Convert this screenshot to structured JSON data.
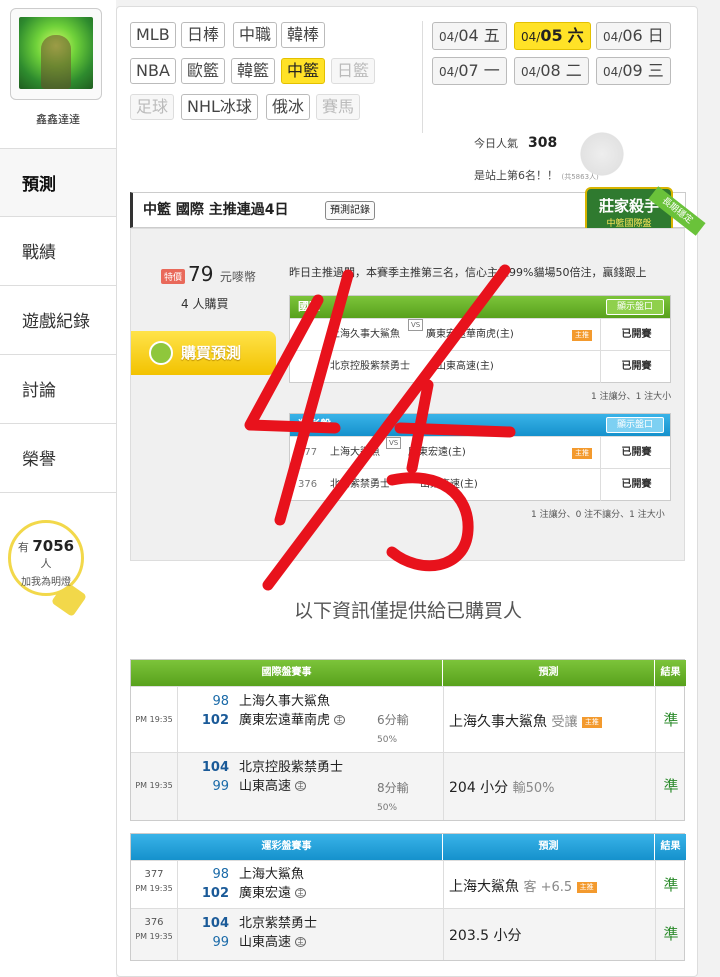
{
  "sidebar": {
    "username": "鑫鑫達達",
    "nav": [
      "預測",
      "戰績",
      "遊戲紀錄",
      "討論",
      "榮譽"
    ],
    "active": "預測",
    "fans": {
      "prefix": "有",
      "count": "7056",
      "unit": "人",
      "label": "加我為明燈"
    }
  },
  "leagues": {
    "row1": [
      "MLB",
      "日棒",
      "中職",
      "韓棒"
    ],
    "row2": [
      "NBA",
      "歐籃",
      "韓籃",
      "中籃",
      "日籃"
    ],
    "row3": [
      "足球",
      "NHL冰球",
      "俄冰",
      "賽馬"
    ],
    "selected": "中籃"
  },
  "dates": [
    {
      "md": "04/",
      "d": "04",
      "w": "五"
    },
    {
      "md": "04/",
      "d": "05",
      "w": "六",
      "selected": true
    },
    {
      "md": "04/",
      "d": "06",
      "w": "日"
    },
    {
      "md": "04/",
      "d": "07",
      "w": "一"
    },
    {
      "md": "04/",
      "d": "08",
      "w": "二"
    },
    {
      "md": "04/",
      "d": "09",
      "w": "三"
    }
  ],
  "popularity": {
    "label": "今日人氣",
    "value": "308",
    "rank_text": "是站上第6名！！",
    "rank_total": "(共5863人)"
  },
  "title": {
    "league": "中籃",
    "type": "國際",
    "streak": "主推連過4日",
    "record_button": "預測記錄"
  },
  "badge": {
    "main": "莊家殺手",
    "sub": "中籃國際盤",
    "ribbon": "長期穩定"
  },
  "purchase": {
    "tag": "特價",
    "price": "79",
    "currency": "元嘜幣",
    "buyers": "4 人購買",
    "button": "購買預測",
    "description": "昨日主推過關，本賽季主推第三名，信心主推99%貓場50倍注，贏錢跟上"
  },
  "intl_panel": {
    "header": "國際",
    "show_button": "顯示盤口",
    "rows": [
      {
        "num": "",
        "team1": "上海久事大鯊魚",
        "team2": "廣東宏遠華南虎(主)",
        "tag": "主推",
        "status": "已開賽"
      },
      {
        "num": "",
        "team1": "北京控股紫禁勇士",
        "team2": "山東高速(主)",
        "tag": "",
        "status": "已開賽"
      }
    ],
    "note": "1 注讓分、1 注大小"
  },
  "lottery_panel": {
    "header": "運彩盤",
    "show_button": "顯示盤口",
    "rows": [
      {
        "num": "377",
        "team1": "上海大鯊魚",
        "team2": "廣東宏遠(主)",
        "tag": "主推",
        "status": "已開賽"
      },
      {
        "num": "376",
        "team1": "北京紫禁勇士",
        "team2": "山東高速(主)",
        "tag": "",
        "status": "已開賽"
      }
    ],
    "note": "1 注讓分、0 注不讓分、1 注大小"
  },
  "info_text": "以下資訊僅提供給已購買人",
  "intl_table": {
    "headers": [
      "國際盤賽事",
      "預測",
      "結果"
    ],
    "rows": [
      {
        "time": "PM 19:35",
        "n1": "98",
        "t1": "上海久事大鯊魚",
        "n2": "102",
        "t2": "廣東宏遠華南虎",
        "spread": "6分輸",
        "pct": "50%",
        "pred": "上海久事大鯊魚",
        "pred_extra": "受讓",
        "tag": "主推",
        "result": "準"
      },
      {
        "time": "PM 19:35",
        "n1": "104",
        "t1": "北京控股紫禁勇士",
        "n2": "99",
        "t2": "山東高速",
        "spread": "8分輸",
        "pct": "50%",
        "pred": "204 小分",
        "pred_extra": "輸50%",
        "tag": "",
        "result": "準"
      }
    ]
  },
  "lottery_table": {
    "headers": [
      "運彩盤賽事",
      "預測",
      "結果"
    ],
    "rows": [
      {
        "gno": "377",
        "time": "PM 19:35",
        "n1": "98",
        "t1": "上海大鯊魚",
        "n2": "102",
        "t2": "廣東宏遠",
        "pred": "上海大鯊魚",
        "pred_extra": "客 +6.5",
        "tag": "主推",
        "result": "準"
      },
      {
        "gno": "376",
        "time": "PM 19:35",
        "n1": "104",
        "t1": "北京紫禁勇士",
        "n2": "99",
        "t2": "山東高速",
        "pred": "203.5 小分",
        "pred_extra": "",
        "tag": "",
        "result": "準"
      }
    ]
  },
  "home_mark": "主",
  "colors": {
    "green": "#58a11c",
    "blue": "#1591cc",
    "yellow": "#ffe227",
    "scribble": "#e8121c"
  }
}
